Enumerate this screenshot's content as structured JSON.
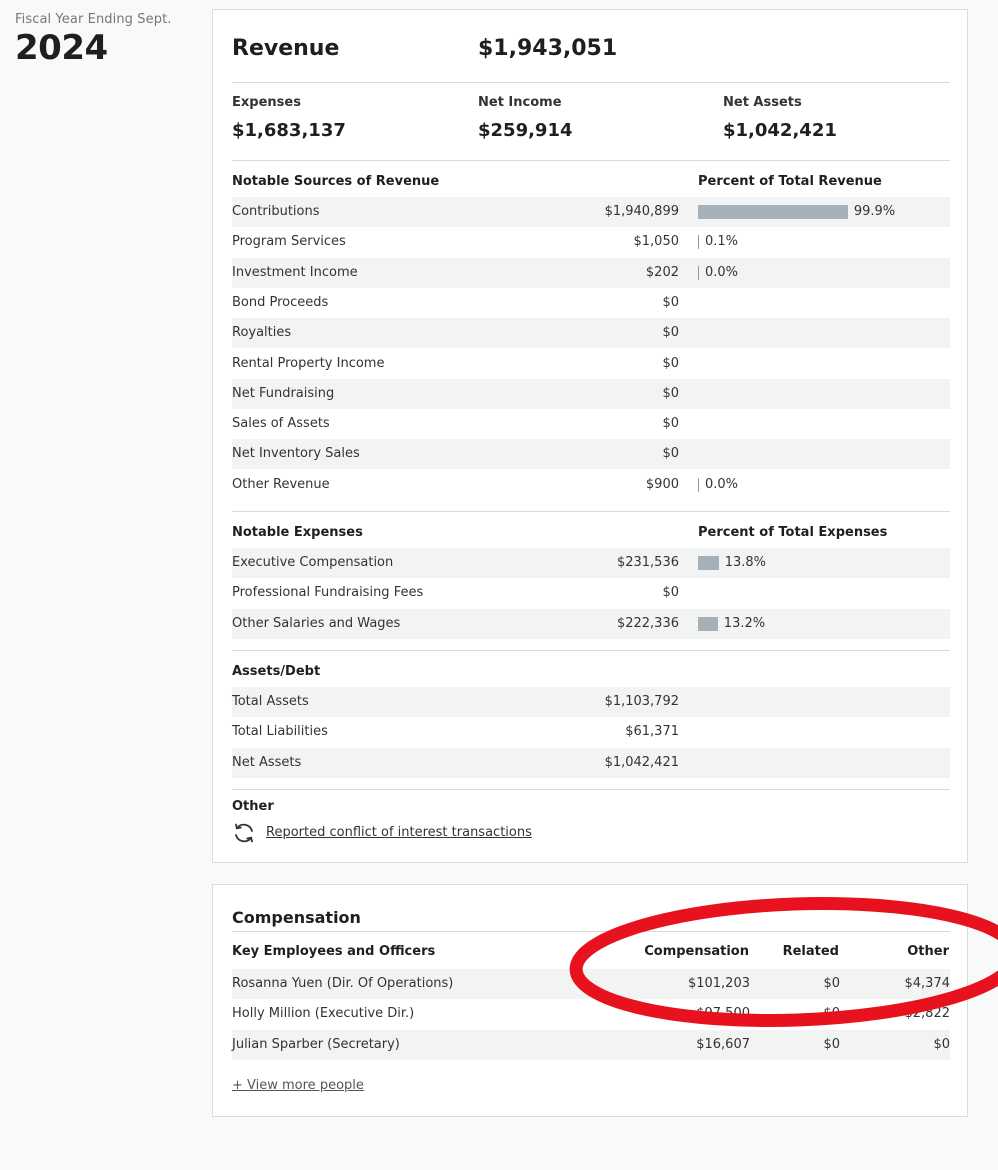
{
  "fiscal": {
    "label": "Fiscal Year Ending Sept.",
    "year": "2024"
  },
  "summary": {
    "revenue_label": "Revenue",
    "revenue_value": "$1,943,051",
    "expenses_label": "Expenses",
    "expenses_value": "$1,683,137",
    "net_income_label": "Net Income",
    "net_income_value": "$259,914",
    "net_assets_label": "Net Assets",
    "net_assets_value": "$1,042,421"
  },
  "revenue_sources": {
    "heading": "Notable Sources of Revenue",
    "pct_heading": "Percent of Total Revenue",
    "rows": [
      {
        "label": "Contributions",
        "amount": "$1,940,899",
        "pct": "99.9%",
        "pct_value": 99.9
      },
      {
        "label": "Program Services",
        "amount": "$1,050",
        "pct": "0.1%",
        "pct_value": 0.1
      },
      {
        "label": "Investment Income",
        "amount": "$202",
        "pct": "0.0%",
        "pct_value": 0.0
      },
      {
        "label": "Bond Proceeds",
        "amount": "$0",
        "pct": ""
      },
      {
        "label": "Royalties",
        "amount": "$0",
        "pct": ""
      },
      {
        "label": "Rental Property Income",
        "amount": "$0",
        "pct": ""
      },
      {
        "label": "Net Fundraising",
        "amount": "$0",
        "pct": ""
      },
      {
        "label": "Sales of Assets",
        "amount": "$0",
        "pct": ""
      },
      {
        "label": "Net Inventory Sales",
        "amount": "$0",
        "pct": ""
      },
      {
        "label": "Other Revenue",
        "amount": "$900",
        "pct": "0.0%",
        "pct_value": 0.0
      }
    ]
  },
  "expenses": {
    "heading": "Notable Expenses",
    "pct_heading": "Percent of Total Expenses",
    "rows": [
      {
        "label": "Executive Compensation",
        "amount": "$231,536",
        "pct": "13.8%",
        "pct_value": 13.8
      },
      {
        "label": "Professional Fundraising Fees",
        "amount": "$0",
        "pct": ""
      },
      {
        "label": "Other Salaries and Wages",
        "amount": "$222,336",
        "pct": "13.2%",
        "pct_value": 13.2
      }
    ]
  },
  "assets_debt": {
    "heading": "Assets/Debt",
    "rows": [
      {
        "label": "Total Assets",
        "amount": "$1,103,792"
      },
      {
        "label": "Total Liabilities",
        "amount": "$61,371"
      },
      {
        "label": "Net Assets",
        "amount": "$1,042,421"
      }
    ]
  },
  "other": {
    "heading": "Other",
    "link": "Reported conflict of interest transactions"
  },
  "compensation": {
    "title": "Compensation",
    "headers": [
      "Key Employees and Officers",
      "Compensation",
      "Related",
      "Other"
    ],
    "rows": [
      {
        "name": "Rosanna Yuen (Dir. Of Operations)",
        "compensation": "$101,203",
        "related": "$0",
        "other": "$4,374"
      },
      {
        "name": "Holly Million (Executive Dir.)",
        "compensation": "$97,500",
        "related": "$0",
        "other": "$2,822"
      },
      {
        "name": "Julian Sparber (Secretary)",
        "compensation": "$16,607",
        "related": "$0",
        "other": "$0"
      }
    ],
    "more_link": "+ View more people"
  },
  "colors": {
    "bar": "#a6b0b8",
    "row_shade": "#f2f3f3",
    "annotation": "#e8121e"
  }
}
